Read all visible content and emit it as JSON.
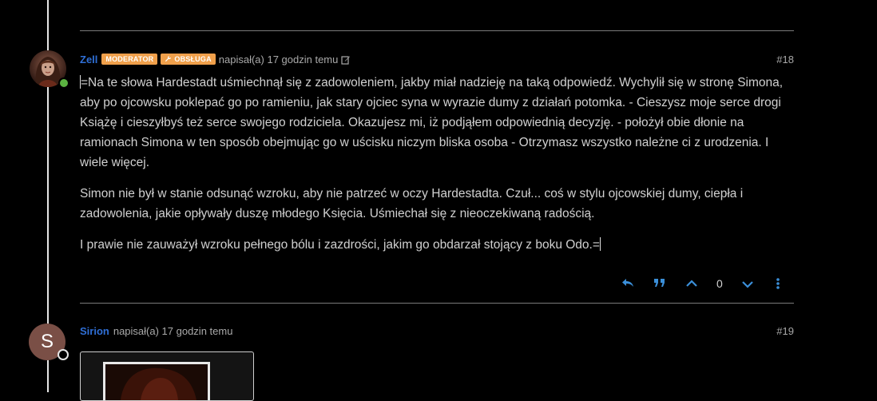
{
  "posts": [
    {
      "username": "Zell",
      "badges": [
        {
          "label": "MODERATOR",
          "icon": "none"
        },
        {
          "label": "OBSŁUGA",
          "icon": "wrench-icon"
        }
      ],
      "meta": "napisał(a) 17 godzin temu",
      "edited_icon": "edit-icon",
      "index": "#18",
      "status": "online",
      "status_color": "#5bb341",
      "paragraphs": [
        "=Na te słowa Hardestadt uśmiechnął się z zadowoleniem, jakby miał nadzieję na taką odpowiedź. Wychylił się w stronę Simona, aby po ojcowsku poklepać go po ramieniu, jak stary ojciec syna w wyrazie dumy z działań potomka. - Cieszysz moje serce drogi Książę i cieszyłbyś też serce swojego rodziciela. Okazujesz mi, iż podjąłem odpowiednią decyzję. - położył obie dłonie na ramionach Simona w ten sposób obejmując go w uścisku niczym bliska osoba - Otrzymasz wszystko należne ci z urodzenia. I wiele więcej.",
        "Simon nie był w stanie odsunąć wzroku, aby nie patrzeć w oczy Hardestadta. Czuł... coś w stylu ojcowskiej dumy, ciepła i zadowolenia, jakie opływały duszę młodego Księcia. Uśmiechał się z nieoczekiwaną radością.",
        "I prawie nie zauważył wzroku pełnego bólu i zazdrości, jakim go obdarzał stojący z boku Odo.="
      ],
      "actions": {
        "reply_icon": "reply-icon",
        "quote_icon": "quote-icon",
        "upvote_icon": "chevron-up-icon",
        "votes": "0",
        "downvote_icon": "chevron-down-icon",
        "more_icon": "more-vertical-icon"
      }
    },
    {
      "username": "Sirion",
      "avatar_letter": "S",
      "avatar_color": "#7a4f46",
      "meta": "napisał(a) 17 godzin temu",
      "index": "#19",
      "status": "offline"
    }
  ],
  "colors": {
    "accent": "#2f6fd6",
    "badge": "#f0a04b",
    "action_icons": "#3b8fd9"
  }
}
